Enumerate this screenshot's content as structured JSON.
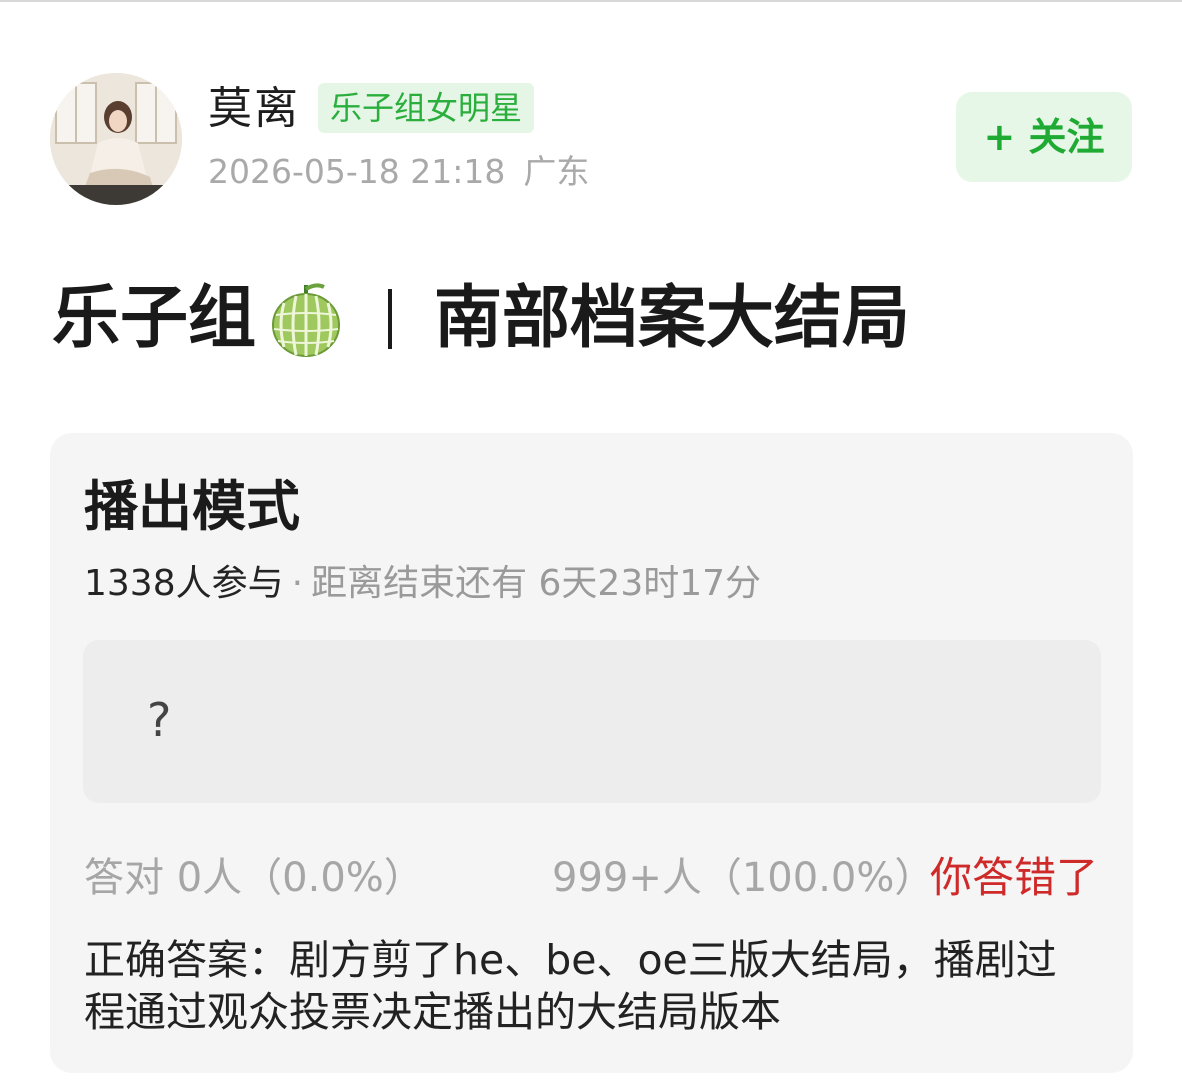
{
  "author": {
    "name": "莫离",
    "badge": "乐子组女明星",
    "date": "2026-05-18 21:18",
    "location": "广东"
  },
  "follow": {
    "label": "+ 关注"
  },
  "post": {
    "title_left": "乐子组",
    "title_right": "南部档案大结局",
    "title_icon": "melon-icon"
  },
  "quiz": {
    "title": "播出模式",
    "participants": "1338人参与",
    "separator": "·",
    "countdown": "距离结束还有 6天23时17分",
    "answer_value": "?",
    "correct_stat": "答对  0人（0.0%）",
    "wrong_stat": "999+人（100.0%）",
    "verdict": "你答错了",
    "explanation": "正确答案：剧方剪了he、be、oe三版大结局，播剧过程通过观众投票决定播出的大结局版本"
  },
  "colors": {
    "accent_green": "#2aae3c",
    "badge_bg": "#e5f6e6",
    "wrong_red": "#cf2a2a",
    "card_bg": "#f5f5f5"
  }
}
